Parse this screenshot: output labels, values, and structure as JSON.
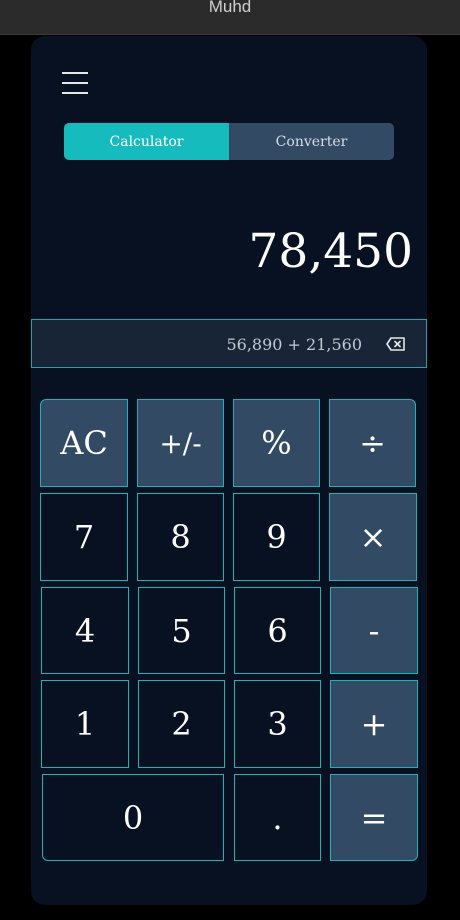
{
  "window": {
    "title": "Muhd"
  },
  "tabs": [
    {
      "label": "Calculator",
      "active": true
    },
    {
      "label": "Converter",
      "active": false
    }
  ],
  "display": {
    "result": "78,450",
    "expression": "56,890 + 21,560"
  },
  "keys": {
    "ac": "AC",
    "plus_minus": "+/-",
    "percent": "%",
    "divide": "÷",
    "seven": "7",
    "eight": "8",
    "nine": "9",
    "multiply": "×",
    "four": "4",
    "five": "5",
    "six": "6",
    "minus": "-",
    "one": "1",
    "two": "2",
    "three": "3",
    "plus": "+",
    "zero": "0",
    "dot": ".",
    "equals": "="
  },
  "colors": {
    "accent": "#16bbbd",
    "background": "#071121",
    "key_light": "#324a63",
    "key_border": "#1fb2b7"
  }
}
